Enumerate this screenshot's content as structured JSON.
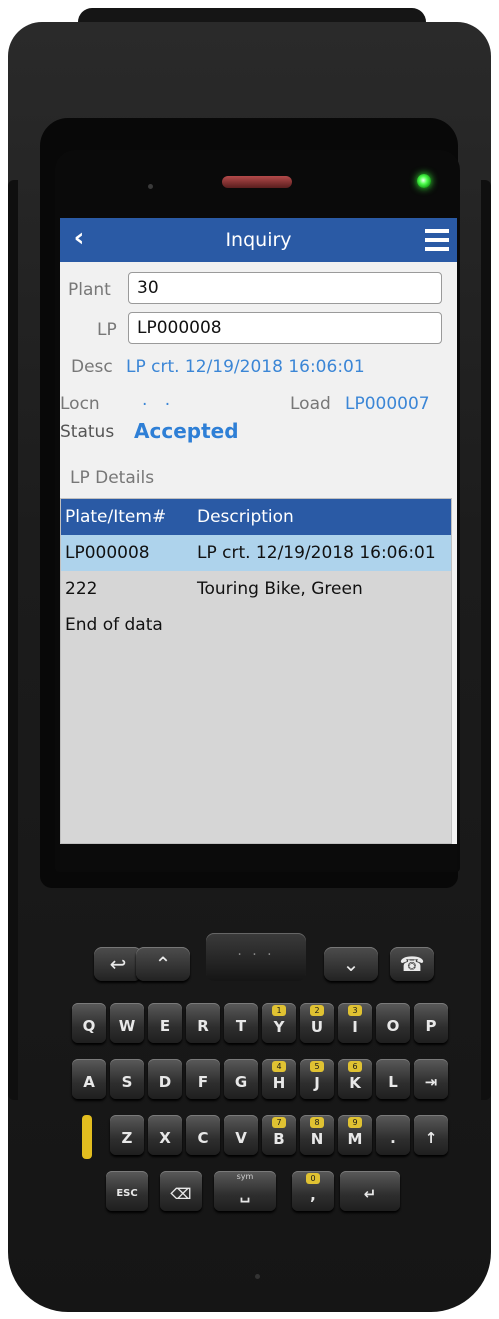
{
  "header": {
    "back_icon": "chevron-left-icon",
    "title": "Inquiry",
    "menu_icon": "hamburger-menu-icon"
  },
  "form": {
    "plant_label": "Plant",
    "plant_value": "30",
    "lp_label": "LP",
    "lp_value": "LP000008",
    "desc_label": "Desc",
    "desc_value": "LP crt. 12/19/2018 16:06:01",
    "locn_label": "Locn",
    "locn_value": ". .",
    "load_label": "Load",
    "load_value": "LP000007",
    "status_label": "Status",
    "status_value": "Accepted"
  },
  "details": {
    "section_label": "LP Details",
    "columns": [
      "Plate/Item#",
      "Description"
    ],
    "rows": [
      {
        "plate": "LP000008",
        "description": "LP crt. 12/19/2018 16:06:01",
        "selected": true
      },
      {
        "plate": "222",
        "description": "Touring Bike, Green",
        "selected": false
      }
    ],
    "end_text": "End of data"
  },
  "keypad": {
    "row1": [
      {
        "sub": "",
        "main": "Q",
        "yellow": false
      },
      {
        "sub": "",
        "main": "W",
        "yellow": false
      },
      {
        "sub": "",
        "main": "E",
        "yellow": false
      },
      {
        "sub": "",
        "main": "R",
        "yellow": false
      },
      {
        "sub": "",
        "main": "T",
        "yellow": false
      },
      {
        "sub": "1",
        "main": "Y",
        "yellow": true
      },
      {
        "sub": "2",
        "main": "U",
        "yellow": true
      },
      {
        "sub": "3",
        "main": "I",
        "yellow": true
      },
      {
        "sub": "",
        "main": "O",
        "yellow": false
      },
      {
        "sub": "",
        "main": "P",
        "yellow": false
      }
    ],
    "row2": [
      {
        "sub": "",
        "main": "A",
        "yellow": false
      },
      {
        "sub": "",
        "main": "S",
        "yellow": false
      },
      {
        "sub": "",
        "main": "D",
        "yellow": false
      },
      {
        "sub": "",
        "main": "F",
        "yellow": false
      },
      {
        "sub": "",
        "main": "G",
        "yellow": false
      },
      {
        "sub": "4",
        "main": "H",
        "yellow": true
      },
      {
        "sub": "5",
        "main": "J",
        "yellow": true
      },
      {
        "sub": "6",
        "main": "K",
        "yellow": true
      },
      {
        "sub": "",
        "main": "L",
        "yellow": false
      },
      {
        "sub": "",
        "main": "⇥",
        "yellow": false
      }
    ],
    "row3": [
      {
        "sub": "",
        "main": "Z",
        "yellow": false
      },
      {
        "sub": "",
        "main": "X",
        "yellow": false
      },
      {
        "sub": "",
        "main": "C",
        "yellow": false
      },
      {
        "sub": "",
        "main": "V",
        "yellow": false
      },
      {
        "sub": "7",
        "main": "B",
        "yellow": true
      },
      {
        "sub": "8",
        "main": "N",
        "yellow": true
      },
      {
        "sub": "9",
        "main": "M",
        "yellow": true
      },
      {
        "sub": "",
        "main": ".",
        "yellow": false
      },
      {
        "sub": "",
        "main": "↑",
        "yellow": false
      }
    ],
    "row4": [
      {
        "sub": "",
        "main": "ESC",
        "yellow": false
      },
      {
        "sub": "",
        "main": "⌫",
        "yellow": false
      },
      {
        "sub": "sym",
        "main": "␣",
        "yellow": false
      },
      {
        "sub": "0",
        "main": ",",
        "yellow": true
      },
      {
        "sub": "",
        "main": "↵",
        "yellow": false
      }
    ],
    "nav": [
      {
        "main": "↩"
      },
      {
        "main": "⌃"
      },
      {
        "main": "⌄"
      },
      {
        "main": "☎"
      }
    ],
    "center_label": "· · ·"
  }
}
